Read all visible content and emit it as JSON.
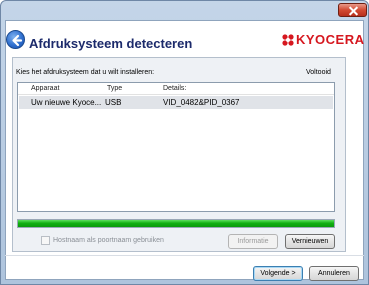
{
  "window": {
    "title": "Afdruksysteem detecteren",
    "brand": "KYOCERA"
  },
  "panel": {
    "instruction": "Kies het afdruksysteem dat u wilt installeren:",
    "status": "Voltooid",
    "columns": [
      "Apparaat",
      "Type",
      "Details:"
    ],
    "rows": [
      {
        "apparaat": "Uw nieuwe Kyoce...",
        "type": "USB",
        "details": "VID_0482&PID_0367"
      }
    ],
    "progress": 1.0
  },
  "options": {
    "hostname_label": "Hostnaam als poortnaam gebruiken",
    "hostname_checked": false
  },
  "buttons": {
    "info": "Informatie",
    "refresh": "Vernieuwen",
    "next": "Volgende >",
    "cancel": "Annuleren"
  },
  "colors": {
    "brand_red": "#d6171f",
    "title_blue": "#1c2a6b",
    "progress_green": "#12b012"
  }
}
